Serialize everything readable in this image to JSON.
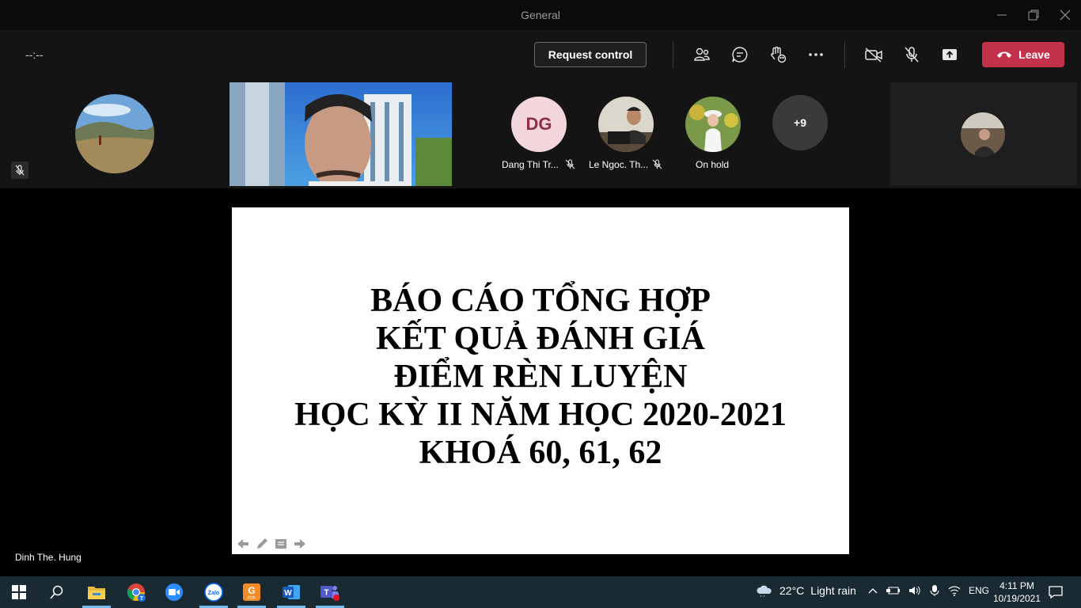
{
  "window": {
    "title": "General"
  },
  "toolbar": {
    "timer": "--:--",
    "request_control_label": "Request control",
    "leave_label": "Leave",
    "leave_color": "#c4314b"
  },
  "participants": [
    {
      "name": "Dang Thi Tr...",
      "initials": "DG",
      "muted": true
    },
    {
      "name": "Le Ngoc. Th...",
      "muted": true
    },
    {
      "name": "On hold",
      "muted": false
    },
    {
      "overflow": "+9"
    }
  ],
  "slide": {
    "lines": [
      "BÁO CÁO TỔNG HỢP",
      "KẾT QUẢ ĐÁNH GIÁ",
      "ĐIỂM RÈN LUYỆN",
      "HỌC KỲ II NĂM HỌC 2020-2021",
      "KHOÁ 60, 61, 62"
    ]
  },
  "presenter": {
    "name": "Dinh The. Hung"
  },
  "taskbar": {
    "apps": [
      "start-icon",
      "search-icon",
      "file-explorer-icon",
      "chrome-icon",
      "zoom-icon",
      "zalo-icon",
      "pdf-reader-icon",
      "word-icon",
      "teams-icon"
    ],
    "weather": {
      "temp": "22°C",
      "condition": "Light rain"
    },
    "language": "ENG",
    "time": "4:11 PM",
    "date": "10/19/2021",
    "zalo_label": "Zalo",
    "pdf_label": "PDF"
  }
}
